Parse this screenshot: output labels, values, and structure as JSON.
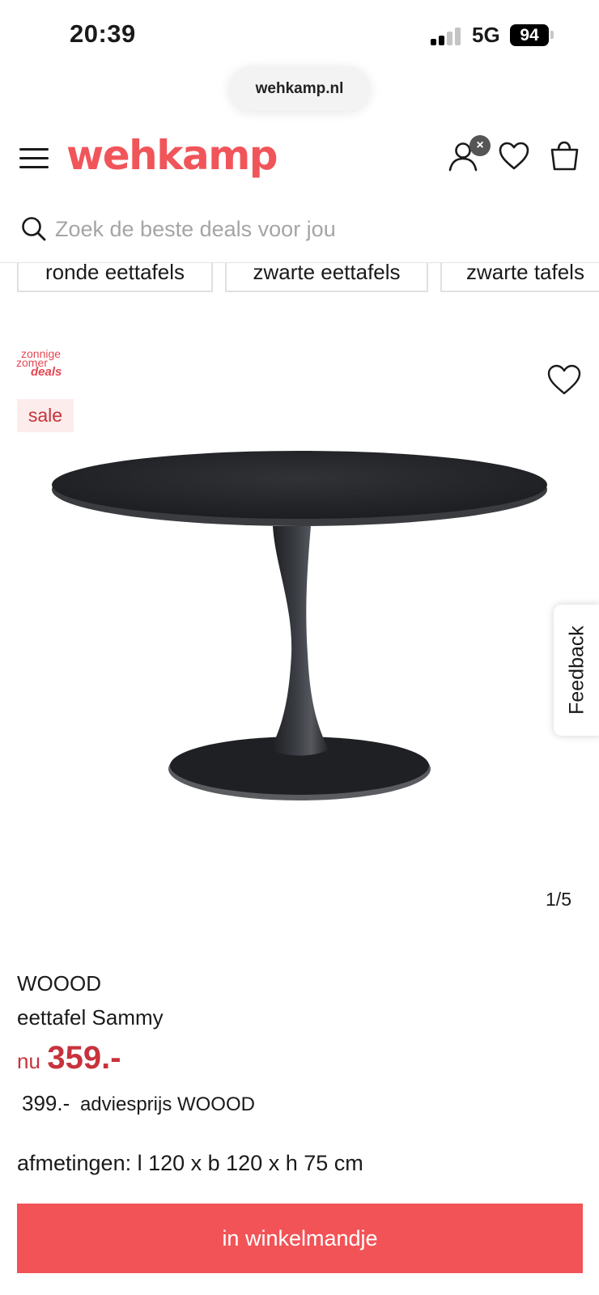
{
  "status_bar": {
    "time": "20:39",
    "network": "5G",
    "battery": "94"
  },
  "browser": {
    "url": "wehkamp.nl"
  },
  "header": {
    "logo": "wehkamp",
    "icons": [
      "menu-icon",
      "account-icon",
      "close-icon",
      "heart-icon",
      "shopping-bag-icon"
    ],
    "account_badge": "×"
  },
  "search": {
    "placeholder": "Zoek de beste deals voor jou"
  },
  "chips": [
    "ronde eettafels",
    "zwarte eettafels",
    "zwarte tafels"
  ],
  "product": {
    "promo": {
      "line1": "zonnige",
      "line2": "zomer",
      "line3": "deals"
    },
    "badge": "sale",
    "image_counter": "1/5",
    "brand": "WOOOD",
    "title": "eettafel Sammy",
    "price_prefix": "nu",
    "price": "359.-",
    "advice_price": "399.-",
    "advice_label": "adviesprijs WOOOD",
    "dimensions": "afmetingen: l 120 x b 120 x h 75 cm"
  },
  "feedback": {
    "label": "Feedback"
  },
  "cart_button": {
    "label": "in winkelmandje"
  },
  "colors": {
    "brand": "#f0555a",
    "price": "#c8323c",
    "button": "#f25357"
  }
}
